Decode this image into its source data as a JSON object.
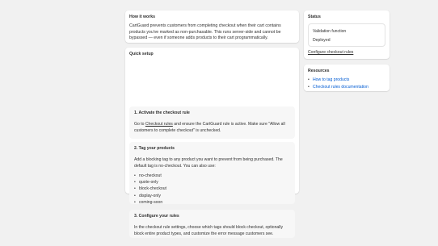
{
  "how_it_works": {
    "title": "How it works",
    "body": "CartGuard prevents customers from completing checkout when their cart contains products you've marked as non-purchasable. This runs server-side and cannot be bypassed — even if someone adds products to their cart programmatically."
  },
  "quick_setup": {
    "title": "Quick setup",
    "step1": {
      "title": "1. Activate the checkout rule",
      "text_before": "Go to ",
      "link": "Checkout rules",
      "text_after": " and ensure the CartGuard rule is active. Make sure \"Allow all customers to complete checkout\" is unchecked."
    },
    "step2": {
      "title": "2. Tag your products",
      "body": "Add a blocking tag to any product you want to prevent from being purchased. The default tag is no-checkout. You can also use:",
      "tags": [
        "no-checkout",
        "quote-only",
        "block-checkout",
        "display-only",
        "coming-soon"
      ]
    },
    "step3": {
      "title": "3. Configure your rules",
      "body": "In the checkout rule settings, choose which tags should block checkout, optionally block entire product types, and customize the error message customers see."
    }
  },
  "status": {
    "title": "Status",
    "validation": "Validation function",
    "state": "Deployed",
    "link": "Configure checkout rules"
  },
  "resources": {
    "title": "Resources",
    "links": [
      "How to tag products",
      "Checkout rules documentation"
    ]
  },
  "colors": {
    "background": "#f1f1f1",
    "card": "#ffffff",
    "link_blue": "#005bd3",
    "step_bg": "#f7f7f7"
  }
}
